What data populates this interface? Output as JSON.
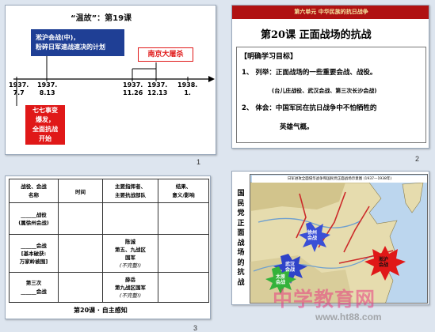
{
  "slide1": {
    "title": "“温故”：第19课",
    "callout_line1": "淞沪会战(中)，",
    "callout_line2": "粉碎日军速战速决的计划",
    "nanjing_label": "南京大屠杀",
    "dates": [
      {
        "y": "1937.",
        "d": "7.7"
      },
      {
        "y": "1937.",
        "d": "8.13"
      },
      {
        "y": "1937.",
        "d": "11.26"
      },
      {
        "y": "1937.",
        "d": "12.13"
      },
      {
        "y": "1938.",
        "d": "1."
      }
    ],
    "red_box_lines": [
      "七七事变",
      "爆发，",
      "全面抗战",
      "开始"
    ],
    "number": "1"
  },
  "slide2": {
    "header": "第六单元    中华民族的抗日战争",
    "title": "第20课 正面战场的抗战",
    "section": "【明确学习目标】",
    "item1": "1、 列举：正面战场的一些重要会战、战役。",
    "item1_sub": "(台儿庄战役、武汉会战、第三次长沙会战)",
    "item2_line1": "2、 体会：中国军民在抗日战争中不怕牺牲的",
    "item2_line2": "英雄气概。",
    "number": "2"
  },
  "slide3": {
    "headers": [
      [
        "战役、会战",
        "名称"
      ],
      [
        "时间"
      ],
      [
        "主要指挥者、",
        "主要抗战部队"
      ],
      [
        "结果、",
        "意义/影响"
      ]
    ],
    "rows": [
      {
        "name": [
          "______战役",
          "(属徐州会战)"
        ],
        "commander": []
      },
      {
        "name": [
          "______会战",
          "[基本破获:",
          "万家岭被围]"
        ],
        "commander": [
          "陈诚",
          "第五、九战区",
          "国军",
          "(不完整!)"
        ]
      },
      {
        "name": [
          "第三次",
          "______会战"
        ],
        "commander": [
          "薛岳",
          "第九战区国军",
          "(不完整!)"
        ]
      }
    ],
    "footer": "第20课 · 自主感知",
    "number": "3"
  },
  "slide4": {
    "side_text": [
      "国",
      "民",
      "党",
      "正",
      "面",
      "战",
      "场",
      "的",
      "抗",
      "战"
    ],
    "map_title": "日军进攻全面侵华战争和国民党正面战场示意图 (1937—1938年)",
    "burst_xuzhou": [
      "徐州",
      "会战"
    ],
    "burst_wuhan": [
      "武汉",
      "会战"
    ],
    "burst_taiyuan": [
      "太原",
      "会战"
    ],
    "burst_songhu": [
      "淞沪",
      "会战"
    ],
    "watermark": "中学教育网",
    "watermark_url": "www.ht88.com",
    "number": "4"
  },
  "colors": {
    "title_bg": "#b01212",
    "callout_blue": "#1f3f95",
    "red": "#e01818",
    "water": "#bcd6ee"
  }
}
